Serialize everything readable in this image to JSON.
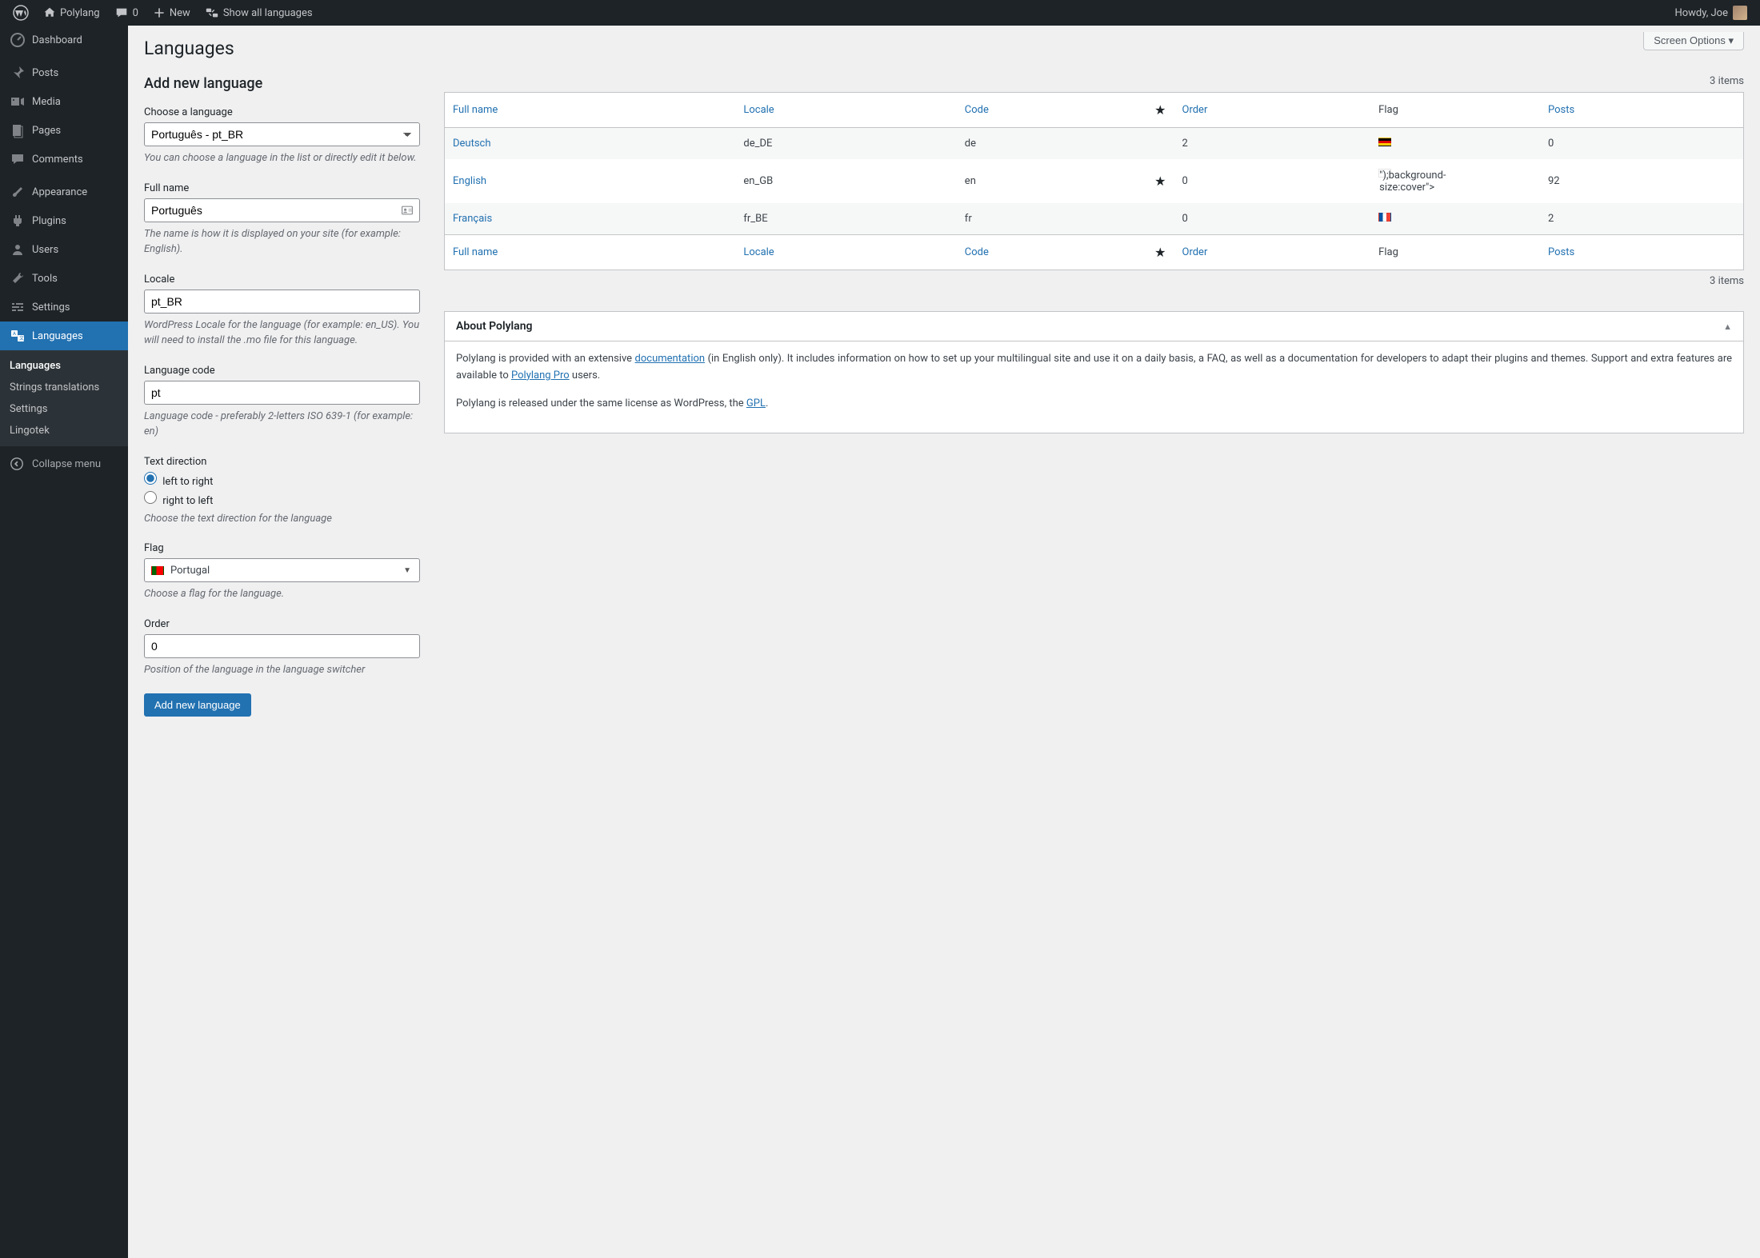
{
  "topbar": {
    "site_name": "Polylang",
    "comments_count": "0",
    "new_label": "New",
    "show_all_label": "Show all languages",
    "howdy": "Howdy, Joe"
  },
  "sidebar": {
    "items": [
      {
        "label": "Dashboard"
      },
      {
        "label": "Posts"
      },
      {
        "label": "Media"
      },
      {
        "label": "Pages"
      },
      {
        "label": "Comments"
      },
      {
        "label": "Appearance"
      },
      {
        "label": "Plugins"
      },
      {
        "label": "Users"
      },
      {
        "label": "Tools"
      },
      {
        "label": "Settings"
      },
      {
        "label": "Languages"
      }
    ],
    "submenu": [
      {
        "label": "Languages",
        "current": true
      },
      {
        "label": "Strings translations"
      },
      {
        "label": "Settings"
      },
      {
        "label": "Lingotek"
      }
    ],
    "collapse": "Collapse menu"
  },
  "screen_options": "Screen Options ▾",
  "page_title": "Languages",
  "items_count_text": "3 items",
  "form": {
    "heading": "Add new language",
    "choose_label": "Choose a language",
    "choose_value": "Português - pt_BR",
    "choose_desc": "You can choose a language in the list or directly edit it below.",
    "fullname_label": "Full name",
    "fullname_value": "Português",
    "fullname_desc": "The name is how it is displayed on your site (for example: English).",
    "locale_label": "Locale",
    "locale_value": "pt_BR",
    "locale_desc": "WordPress Locale for the language (for example: en_US). You will need to install the .mo file for this language.",
    "code_label": "Language code",
    "code_value": "pt",
    "code_desc": "Language code - preferably 2-letters ISO 639-1 (for example: en)",
    "direction_label": "Text direction",
    "ltr_label": "left to right",
    "rtl_label": "right to left",
    "direction_desc": "Choose the text direction for the language",
    "flag_label": "Flag",
    "flag_value": "Portugal",
    "flag_desc": "Choose a flag for the language.",
    "order_label": "Order",
    "order_value": "0",
    "order_desc": "Position of the language in the language switcher",
    "submit": "Add new language"
  },
  "table": {
    "columns": {
      "fullname": "Full name",
      "locale": "Locale",
      "code": "Code",
      "order": "Order",
      "flag": "Flag",
      "posts": "Posts"
    },
    "rows": [
      {
        "name": "Deutsch",
        "locale": "de_DE",
        "code": "de",
        "default": false,
        "order": "2",
        "flag": "de",
        "posts": "0"
      },
      {
        "name": "English",
        "locale": "en_GB",
        "code": "en",
        "default": true,
        "order": "0",
        "flag": "gb",
        "posts": "92"
      },
      {
        "name": "Français",
        "locale": "fr_BE",
        "code": "fr",
        "default": false,
        "order": "0",
        "flag": "fr",
        "posts": "2"
      }
    ]
  },
  "about": {
    "heading": "About Polylang",
    "p1a": "Polylang is provided with an extensive ",
    "link1": "documentation",
    "p1b": " (in English only). It includes information on how to set up your multilingual site and use it on a daily basis, a FAQ, as well as a documentation for developers to adapt their plugins and themes. Support and extra features are available to ",
    "link2": "Polylang Pro",
    "p1c": " users.",
    "p2a": "Polylang is released under the same license as WordPress, the ",
    "link3": "GPL",
    "p2b": "."
  },
  "flag_colors": {
    "de": "linear-gradient(to bottom,#000 33%,#dd0000 33% 66%,#ffce00 66%)",
    "gb": "url(\"data:image/svg+xml;utf8,<svg xmlns='http://www.w3.org/2000/svg' viewBox='0 0 16 11'><rect width='16' height='11' fill='%2300247d'/><path d='M0,0 L16,11 M16,0 L0,11' stroke='white' stroke-width='2'/><path d='M0,0 L16,11 M16,0 L0,11' stroke='%23cf142b' stroke-width='1'/><path d='M8,0 V11 M0,5.5 H16' stroke='white' stroke-width='3'/><path d='M8,0 V11 M0,5.5 H16' stroke='%23cf142b' stroke-width='1.8'/></svg>\")",
    "fr": "linear-gradient(to right,#0055a4 33%,#fff 33% 66%,#ef4135 66%)",
    "pt": "linear-gradient(to right,#006600 40%,#ff0000 40%)"
  }
}
